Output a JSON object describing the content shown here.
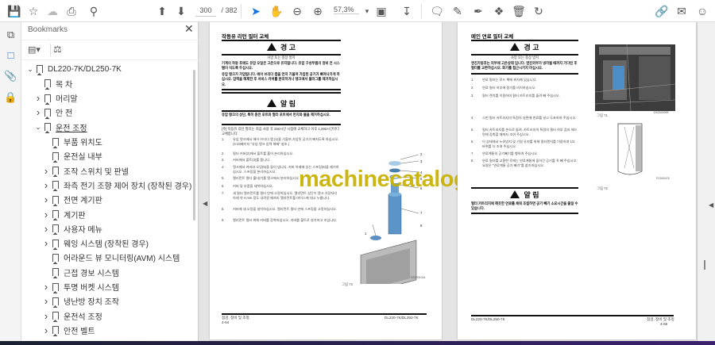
{
  "toolbar": {
    "current_page": "300",
    "total_pages": "/ 382",
    "zoom": "57,3%"
  },
  "bookmarks_panel": {
    "title": "Bookmarks",
    "items": [
      {
        "label": "DL220-7K/DL250-7K",
        "level": 0,
        "expanded": true
      },
      {
        "label": "목 차",
        "level": 1
      },
      {
        "label": "머리말",
        "level": 1,
        "collapsed": true
      },
      {
        "label": "안 전",
        "level": 1,
        "collapsed": true
      },
      {
        "label": "운전 조정",
        "level": 1,
        "expanded": true
      },
      {
        "label": "부품 위치도",
        "level": 2
      },
      {
        "label": "운전실 내부",
        "level": 2
      },
      {
        "label": "조작 스위치 및 판넬",
        "level": 2,
        "collapsed": true
      },
      {
        "label": "좌측 전기 조향 제어 장치 (장착된 경우)",
        "level": 2,
        "collapsed": true
      },
      {
        "label": "전면 계기판",
        "level": 2,
        "collapsed": true
      },
      {
        "label": "계기판",
        "level": 2,
        "collapsed": true
      },
      {
        "label": "사용자 메뉴",
        "level": 2,
        "collapsed": true
      },
      {
        "label": "웨잉 시스템 (장착된 경우)",
        "level": 2,
        "collapsed": true
      },
      {
        "label": "어라운드 뷰 모니터링(AVM) 시스템",
        "level": 2
      },
      {
        "label": "근접 경보 시스템",
        "level": 2
      },
      {
        "label": "투명 버켓 시스템",
        "level": 2,
        "collapsed": true
      },
      {
        "label": "냉난방 장치 조작",
        "level": 2,
        "collapsed": true
      },
      {
        "label": "운전석 조정",
        "level": 2,
        "collapsed": true
      },
      {
        "label": "안전 벨트",
        "level": 2,
        "collapsed": true
      }
    ]
  },
  "left_page": {
    "title": "작동유 리턴 필터 교체",
    "warning_title": "경 고",
    "warning_sub": "사망 또는 중상 방지",
    "warning_p1": "기계의 작동 후에도 유압 오일은 고온으로 유지됩니다. 유압 구성부품의 정비 전 시스템이 식도록 두십시오.",
    "warning_p2": "유압 탱크가 가압됩니다. 에어 브리더 캡을 먼저 기울여 가압된 공기가 빠져나가게 하십시오. 압력을 해제한 후 서비스 커버를 분리하거나 탱크에서 플러그를 제거하십시오.",
    "notice_title": "알 림",
    "notice_p": "유압 탱크의 상단, 특히 충전 포트와 필터 포트에서 먼지와 물을 제거하십시오.",
    "note": "[주] 작동유 리턴 필터는 처음 사용 후 250시간 시점에 교체하고 이후 1,000시간마다 교체합니다.",
    "steps": [
      "유압 탱크에서 에어 브리더 캡 (1)을 기울여 가압된 공기가 빠지도록 하십시오. (4-33페이지 \"유압 탱크 압력 해제\" 참조.)",
      "필터 커버(2)에서 볼트를 풀어 분리하십시오.",
      "커버에서 볼트(3)를 풉니다.",
      "탱크에서 커버와 오링(5)을 들어 냅니다. 커버 아래에 있는 스프링(6)을 제거하십시오. 스프링을 분리하십시오.",
      "엘리먼트 필터 홀더(7)를 탱크에서 분리하십시오.",
      "커버 및 부품을 세척하십시오.",
      "새 필터 엘리먼트를 필터 안에 고정하십시오. 엘리먼트 상단이 탱크 가장자리 아래 약 4 mm 정도 내려갈 때까지 엘리먼트를 바이스에 대고 누릅니다.",
      "커버에 새 오링을 설치하십시오. 엘리먼트 필터 안에 스프링을 고정하십시오.",
      "엘리먼트 필터 위에 커버를 장착하십시오. 커버를 볼트로 설치하고 조입니다."
    ],
    "figure_caption": "그림 73",
    "figure_code": "DS2001004",
    "callouts": [
      "1",
      "2",
      "3",
      "4",
      "5",
      "6",
      "7",
      "8"
    ],
    "footer_section": "점검, 정비 및 조정",
    "footer_page": "4-64",
    "footer_model": "DL220-7K/DL250-7K"
  },
  "right_page": {
    "title": "메인 연료 필터 교체",
    "warning_title": "경 고",
    "warning_sub": "사망 또는 중상 방지",
    "warning_p": "엔진가동후는 외부에 고온상태 입니다. 엔진외부가 냉각될 때까지 기다린 후 필터를 교환하십시오. 화기를 접근시키지 마십시오.",
    "steps_a": [
      "연료 필터는 로드 팩에 위치해 있습니다.",
      "연료 필터 하부에 용기를 비치하십시오.",
      "필터 렌치를 이용하여 필터 카트리지를 돌려 빼 주십시오."
    ],
    "steps_b": [
      "스핀 필터 카트리지의 특정의 실면에 연료를 넣고 도포하여 주십시오.",
      "필터 카트리지를 손으로 돌려, 카트리지의 특정의 필터 하부 접지 헤드면에 접촉할 때까지 조여 주십시오.",
      "이 상태에서 누유방지 및 기밀 유지를 위해 필터렌치를 이용하여 1/2 바퀴를 더 조여 주십시오.",
      "연료계통의 공기빼기를 행하여 주십시오.",
      "연료 필터를 교환한 후에는 연료계통에 들어간 공기를 꼭 빼 주십시오. 요령은 \"연료계통 공기 빼기\"를 참조하십시오."
    ],
    "figure1_caption": "그림 71",
    "figure1_code": "DS2000995",
    "figure2_caption": "그림 72",
    "figure2_code": "FG000478",
    "notice_title": "알 림",
    "notice_p": "필터 카트리지에 깨끗한 연료를 채워 조립하면 공기 빼기 소요시간을 줄일 수 있습니다.",
    "footer_model": "DL220-7K/DL250-7K",
    "footer_section": "점검, 정비 및 조정",
    "footer_page": "4-65"
  },
  "watermark": "machinecatalogic.com",
  "colors": {
    "accent": "#1473e6",
    "watermark": "#c8b000"
  }
}
